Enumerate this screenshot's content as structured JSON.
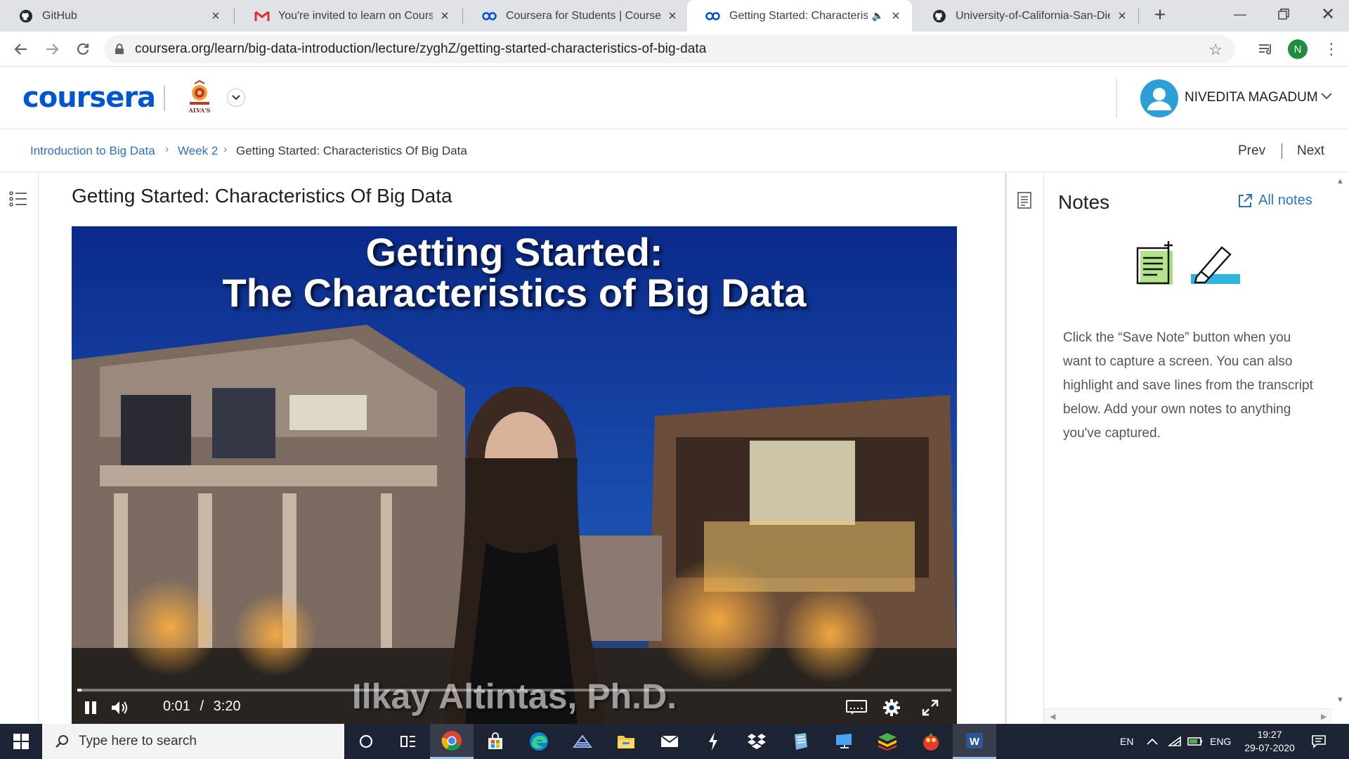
{
  "browser": {
    "tabs": [
      {
        "title": "GitHub",
        "icon": "github-icon",
        "active": false
      },
      {
        "title": "You're invited to learn on Course",
        "icon": "gmail-icon",
        "active": false
      },
      {
        "title": "Coursera for Students | Coursera",
        "icon": "coursera-icon",
        "active": false
      },
      {
        "title": "Getting Started: Characterist",
        "icon": "coursera-icon",
        "active": true,
        "audio": true
      },
      {
        "title": "University-of-California-San-Die",
        "icon": "github-icon",
        "active": false
      }
    ],
    "url": "coursera.org/learn/big-data-introduction/lecture/zyghZ/getting-started-characteristics-of-big-data",
    "profile_initial": "N"
  },
  "header": {
    "logo": "coursera",
    "partner_badge": "ALVA'S",
    "user_name": "NIVEDITA MAGADUM"
  },
  "breadcrumb": {
    "items": [
      "Introduction to Big Data",
      "Week 2"
    ],
    "current": "Getting Started: Characteristics Of Big Data",
    "separator": "›",
    "prev": "Prev",
    "next": "Next"
  },
  "lecture": {
    "title": "Getting Started: Characteristics Of Big Data",
    "video": {
      "slide_title_line1": "Getting Started:",
      "slide_title_line2": "The Characteristics of Big Data",
      "speaker_caption": "Ilkay Altintas, Ph.D.",
      "current_time": "0:01",
      "time_separator": "/",
      "duration": "3:20",
      "progress": 0.005
    }
  },
  "notes": {
    "title": "Notes",
    "all_notes": "All notes",
    "help_text": "Click the “Save Note” button when you want to capture a screen. You can also highlight and save lines from the transcript below. Add your own notes to anything you've captured."
  },
  "taskbar": {
    "search_placeholder": "Type here to search",
    "lang_short": "EN",
    "lang": "ENG",
    "time": "19:27",
    "date": "29-07-2020"
  },
  "colors": {
    "coursera_blue": "#0056d2",
    "link_blue": "#2a73cc",
    "avatar_blue": "#2a9fd8",
    "tabstrip": "#dee1e6",
    "taskbar": "#1c2333"
  }
}
